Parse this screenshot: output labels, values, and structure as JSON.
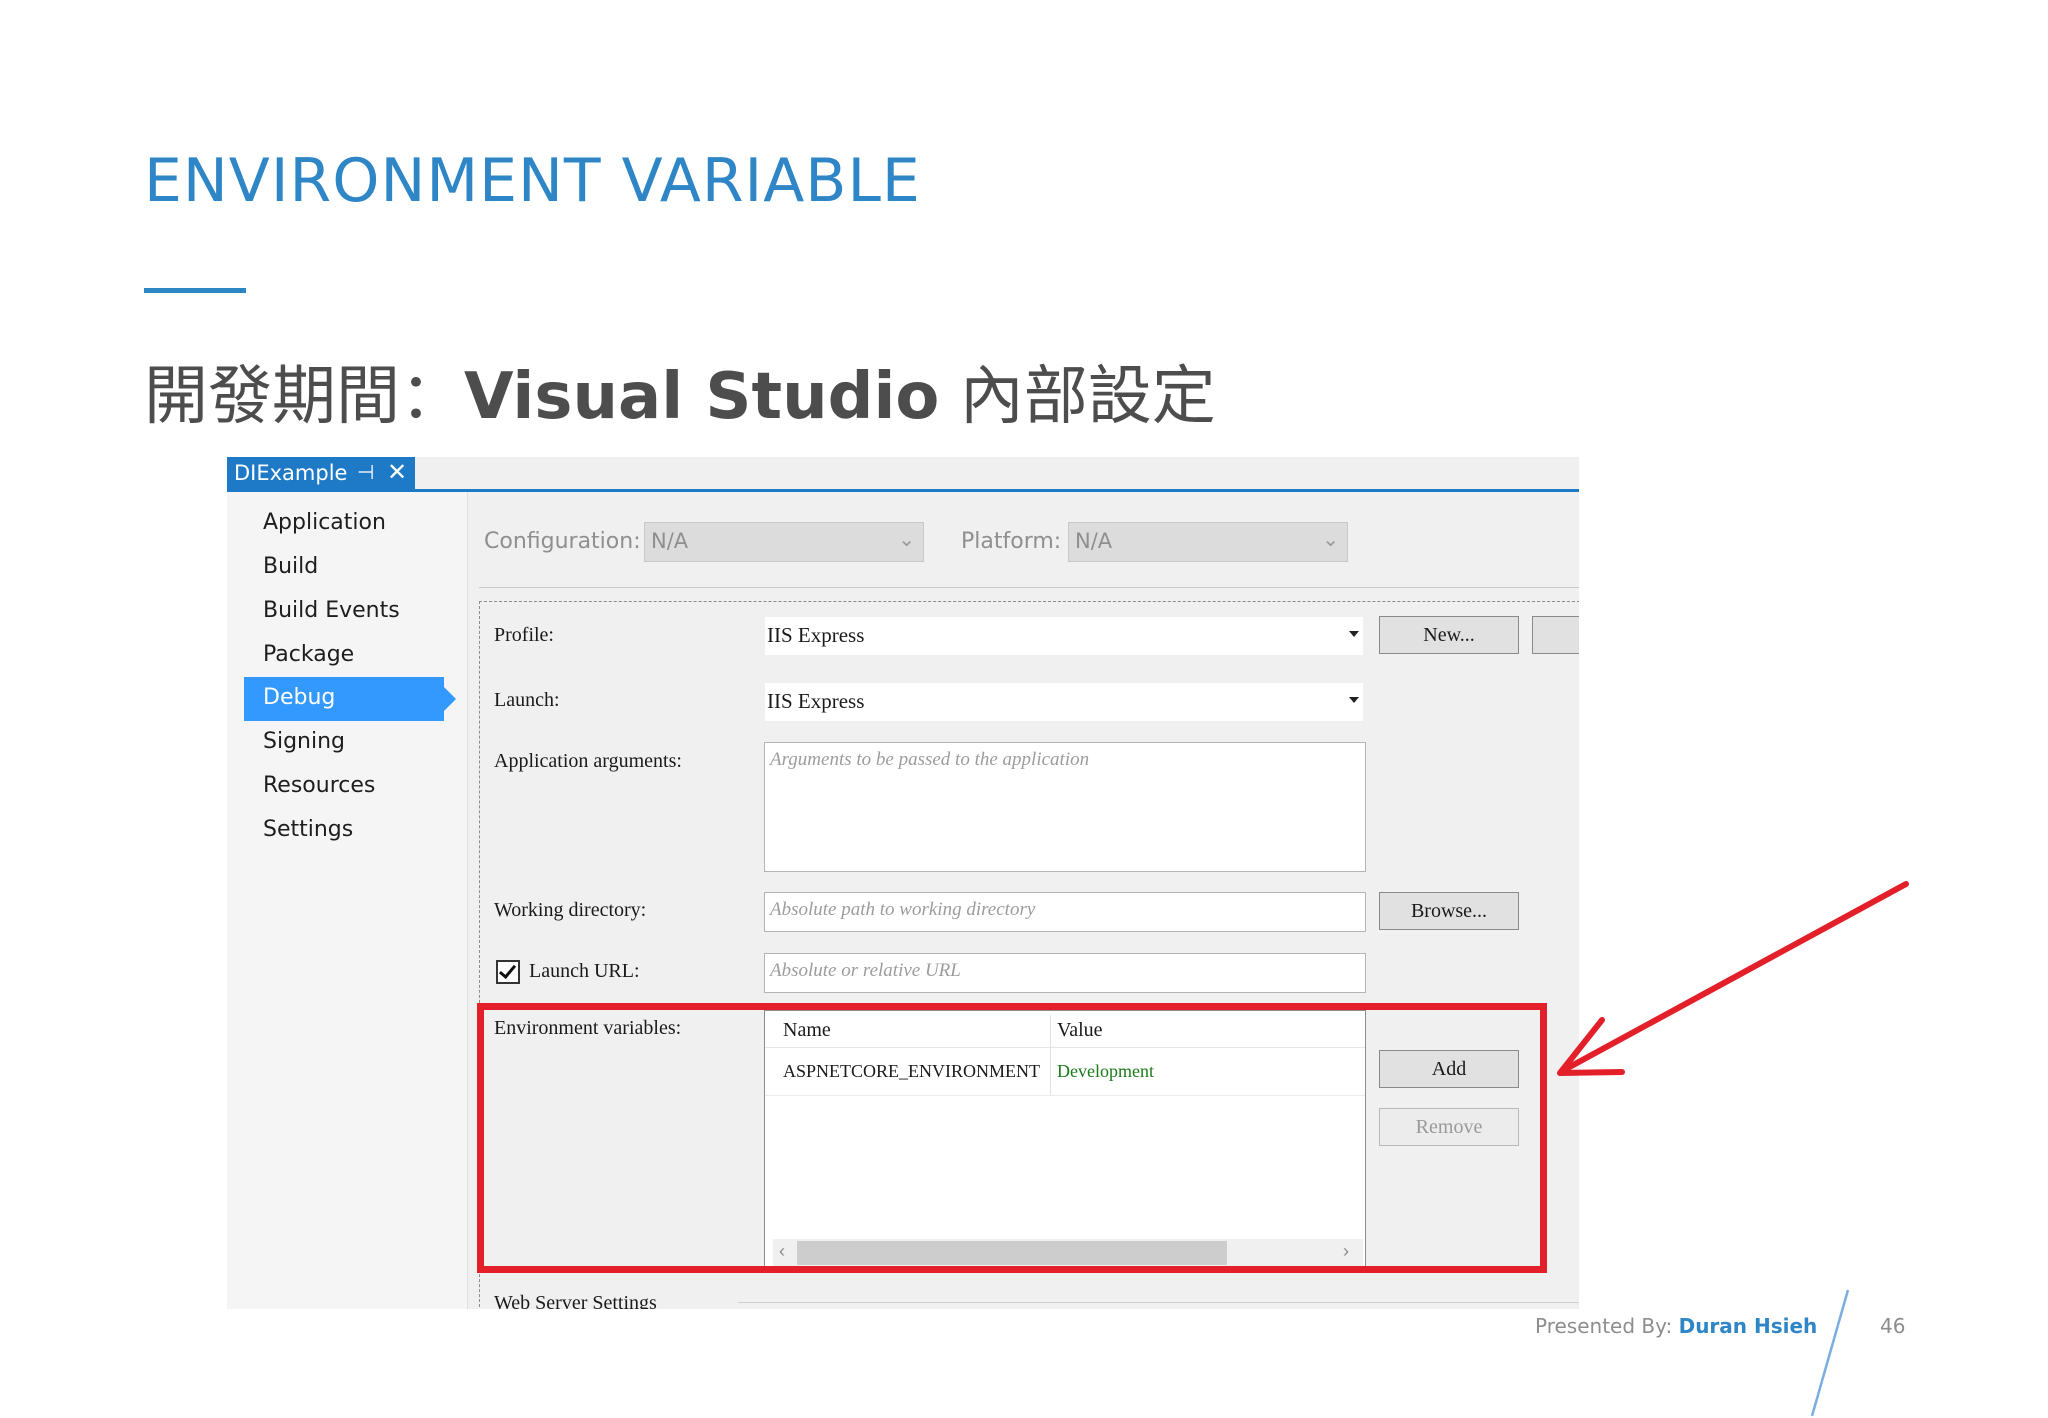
{
  "slide": {
    "title": "ENVIRONMENT VARIABLE",
    "subtitle_prefix": "開發期間：",
    "subtitle_bold": "Visual Studio",
    "subtitle_suffix": " 內部設定",
    "accent_color": "#2e86c6"
  },
  "vs": {
    "tab": {
      "title": "DIExample",
      "pin_icon": "pin-icon",
      "close_icon": "close-icon"
    },
    "nav": {
      "items": [
        {
          "label": "Application",
          "active": false
        },
        {
          "label": "Build",
          "active": false
        },
        {
          "label": "Build Events",
          "active": false
        },
        {
          "label": "Package",
          "active": false
        },
        {
          "label": "Debug",
          "active": true
        },
        {
          "label": "Signing",
          "active": false
        },
        {
          "label": "Resources",
          "active": false
        },
        {
          "label": "Settings",
          "active": false
        }
      ]
    },
    "config": {
      "configuration_label": "Configuration:",
      "configuration_value": "N/A",
      "platform_label": "Platform:",
      "platform_value": "N/A"
    },
    "form": {
      "profile_label": "Profile:",
      "profile_value": "IIS Express",
      "new_button": "New...",
      "launch_label": "Launch:",
      "launch_value": "IIS Express",
      "app_args_label": "Application arguments:",
      "app_args_placeholder": "Arguments to be passed to the application",
      "working_dir_label": "Working directory:",
      "working_dir_placeholder": "Absolute path to working directory",
      "browse_button": "Browse...",
      "launch_url_label": "Launch URL:",
      "launch_url_checked": true,
      "launch_url_placeholder": "Absolute or relative URL",
      "env_vars_label": "Environment variables:",
      "env_grid": {
        "columns": [
          "Name",
          "Value"
        ],
        "rows": [
          {
            "name": "ASPNETCORE_ENVIRONMENT",
            "value": "Development"
          }
        ]
      },
      "add_button": "Add",
      "remove_button": "Remove",
      "web_server_settings_label": "Web Server Settings"
    },
    "highlight_color": "#e3202a"
  },
  "footer": {
    "presented_by": "Presented By: ",
    "presenter": "Duran Hsieh",
    "page_number": "46"
  }
}
